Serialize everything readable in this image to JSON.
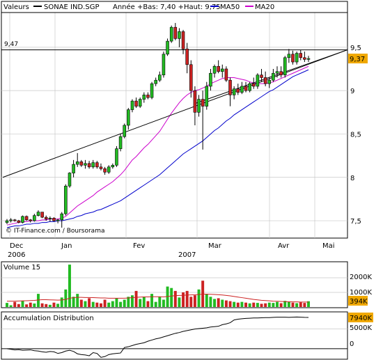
{
  "chart_data": [
    {
      "type": "candlestick",
      "legend": {
        "prefix": "Valeurs",
        "symbol": "SONAE IND.SGP",
        "range_text": "Année +Bas: 7,40 +Haut: 9,75",
        "ma50": "MA50",
        "ma20": "MA20",
        "colors": {
          "symbol": "#000000",
          "ma50": "#0000cc",
          "ma20": "#cc00cc"
        }
      },
      "y_ticks": [
        "9,5",
        "9",
        "8,5",
        "8",
        "7,5"
      ],
      "ylim": [
        7.3,
        9.9
      ],
      "reference_line": {
        "label": "9,47",
        "value": 9.47
      },
      "last_price": {
        "label": "9,37",
        "value": 9.37,
        "color": "#f0a800"
      },
      "x_ticks": [
        "Dec",
        "Jan",
        "Fev",
        "Mar",
        "Avr",
        "Mai"
      ],
      "year_labels": [
        "2006",
        "2007"
      ],
      "credit": "© IT-Finance.com / Boursorama",
      "candles": [
        [
          7.48,
          7.52,
          7.46,
          7.5
        ],
        [
          7.5,
          7.53,
          7.48,
          7.51
        ],
        [
          7.51,
          7.52,
          7.49,
          7.5
        ],
        [
          7.5,
          7.51,
          7.47,
          7.48
        ],
        [
          7.48,
          7.56,
          7.47,
          7.55
        ],
        [
          7.55,
          7.56,
          7.5,
          7.51
        ],
        [
          7.51,
          7.52,
          7.48,
          7.5
        ],
        [
          7.5,
          7.58,
          7.49,
          7.56
        ],
        [
          7.56,
          7.62,
          7.55,
          7.6
        ],
        [
          7.6,
          7.6,
          7.53,
          7.54
        ],
        [
          7.54,
          7.56,
          7.5,
          7.52
        ],
        [
          7.52,
          7.55,
          7.49,
          7.53
        ],
        [
          7.53,
          7.54,
          7.49,
          7.5
        ],
        [
          7.5,
          7.52,
          7.47,
          7.51
        ],
        [
          7.51,
          7.6,
          7.42,
          7.58
        ],
        [
          7.58,
          7.92,
          7.56,
          7.9
        ],
        [
          7.9,
          8.06,
          7.88,
          8.05
        ],
        [
          8.05,
          8.2,
          8.0,
          8.15
        ],
        [
          8.15,
          8.28,
          8.12,
          8.18
        ],
        [
          8.18,
          8.2,
          8.12,
          8.14
        ],
        [
          8.14,
          8.2,
          8.1,
          8.16
        ],
        [
          8.16,
          8.19,
          8.1,
          8.12
        ],
        [
          8.12,
          8.2,
          8.1,
          8.17
        ],
        [
          8.17,
          8.19,
          8.1,
          8.12
        ],
        [
          8.12,
          8.16,
          8.08,
          8.1
        ],
        [
          8.1,
          8.12,
          8.03,
          8.06
        ],
        [
          8.06,
          8.14,
          8.04,
          8.12
        ],
        [
          8.12,
          8.16,
          8.1,
          8.14
        ],
        [
          8.14,
          8.36,
          8.12,
          8.33
        ],
        [
          8.33,
          8.5,
          8.3,
          8.47
        ],
        [
          8.47,
          8.62,
          8.45,
          8.6
        ],
        [
          8.6,
          8.8,
          8.55,
          8.78
        ],
        [
          8.78,
          8.9,
          8.75,
          8.88
        ],
        [
          8.88,
          8.92,
          8.8,
          8.82
        ],
        [
          8.82,
          8.92,
          8.8,
          8.9
        ],
        [
          8.9,
          8.98,
          8.86,
          8.95
        ],
        [
          8.95,
          8.98,
          8.9,
          8.92
        ],
        [
          8.92,
          9.1,
          8.9,
          9.08
        ],
        [
          9.08,
          9.15,
          9.05,
          9.12
        ],
        [
          9.12,
          9.22,
          9.1,
          9.18
        ],
        [
          9.18,
          9.45,
          9.15,
          9.42
        ],
        [
          9.42,
          9.6,
          9.4,
          9.57
        ],
        [
          9.57,
          9.75,
          9.55,
          9.73
        ],
        [
          9.73,
          9.78,
          9.58,
          9.6
        ],
        [
          9.6,
          9.72,
          9.5,
          9.68
        ],
        [
          9.68,
          9.7,
          9.42,
          9.48
        ],
        [
          9.48,
          9.55,
          9.2,
          9.3
        ],
        [
          9.3,
          9.35,
          8.92,
          9.0
        ],
        [
          9.0,
          9.05,
          8.6,
          8.75
        ],
        [
          8.75,
          8.95,
          8.7,
          8.9
        ],
        [
          8.9,
          9.0,
          8.32,
          8.82
        ],
        [
          8.82,
          9.1,
          8.78,
          9.05
        ],
        [
          9.05,
          9.25,
          9.0,
          9.2
        ],
        [
          9.2,
          9.3,
          9.15,
          9.28
        ],
        [
          9.28,
          9.35,
          9.2,
          9.22
        ],
        [
          9.22,
          9.3,
          9.15,
          9.25
        ],
        [
          9.25,
          9.28,
          9.1,
          9.12
        ],
        [
          9.12,
          9.15,
          8.82,
          8.95
        ],
        [
          8.95,
          9.05,
          8.9,
          9.02
        ],
        [
          9.02,
          9.08,
          8.95,
          8.98
        ],
        [
          8.98,
          9.1,
          8.96,
          9.05
        ],
        [
          9.05,
          9.1,
          8.98,
          9.0
        ],
        [
          9.0,
          9.1,
          8.98,
          9.08
        ],
        [
          9.08,
          9.15,
          9.02,
          9.05
        ],
        [
          9.05,
          9.2,
          9.02,
          9.18
        ],
        [
          9.18,
          9.25,
          9.1,
          9.15
        ],
        [
          9.15,
          9.22,
          9.05,
          9.08
        ],
        [
          9.08,
          9.15,
          9.03,
          9.12
        ],
        [
          9.12,
          9.25,
          9.1,
          9.2
        ],
        [
          9.2,
          9.28,
          9.15,
          9.22
        ],
        [
          9.22,
          9.28,
          9.15,
          9.18
        ],
        [
          9.18,
          9.4,
          9.15,
          9.38
        ],
        [
          9.38,
          9.48,
          9.32,
          9.42
        ],
        [
          9.42,
          9.46,
          9.3,
          9.33
        ],
        [
          9.33,
          9.45,
          9.3,
          9.43
        ],
        [
          9.43,
          9.47,
          9.35,
          9.38
        ],
        [
          9.38,
          9.45,
          9.33,
          9.36
        ],
        [
          9.36,
          9.4,
          9.33,
          9.37
        ]
      ],
      "ma20": [
        7.45,
        7.46,
        7.47,
        7.48,
        7.49,
        7.49,
        7.5,
        7.5,
        7.5,
        7.51,
        7.51,
        7.52,
        7.52,
        7.52,
        7.53,
        7.55,
        7.59,
        7.63,
        7.67,
        7.7,
        7.73,
        7.76,
        7.79,
        7.83,
        7.86,
        7.89,
        7.92,
        7.95,
        7.99,
        8.03,
        8.08,
        8.14,
        8.2,
        8.24,
        8.29,
        8.34,
        8.38,
        8.43,
        8.48,
        8.53,
        8.6,
        8.67,
        8.74,
        8.8,
        8.86,
        8.91,
        8.95,
        8.98,
        9.0,
        9.01,
        9.03,
        9.05,
        9.08,
        9.1,
        9.12,
        9.14,
        9.15,
        9.15,
        9.15,
        9.14,
        9.13,
        9.12,
        9.1,
        9.09,
        9.08,
        9.08,
        9.08,
        9.09,
        9.1,
        9.12,
        9.14,
        9.16,
        9.18,
        9.2,
        9.22,
        9.24,
        9.26,
        9.28
      ],
      "ma50": [
        7.42,
        7.43,
        7.44,
        7.44,
        7.45,
        7.46,
        7.46,
        7.47,
        7.47,
        7.48,
        7.48,
        7.49,
        7.49,
        7.5,
        7.5,
        7.51,
        7.52,
        7.53,
        7.55,
        7.56,
        7.58,
        7.59,
        7.6,
        7.62,
        7.63,
        7.65,
        7.67,
        7.69,
        7.71,
        7.73,
        7.76,
        7.79,
        7.82,
        7.85,
        7.88,
        7.91,
        7.94,
        7.97,
        8.0,
        8.03,
        8.07,
        8.11,
        8.15,
        8.19,
        8.23,
        8.27,
        8.3,
        8.33,
        8.36,
        8.39,
        8.42,
        8.46,
        8.5,
        8.54,
        8.57,
        8.61,
        8.65,
        8.68,
        8.72,
        8.75,
        8.78,
        8.81,
        8.84,
        8.87,
        8.9,
        8.93,
        8.96,
        8.99,
        9.01,
        9.04,
        9.07,
        9.1,
        9.13,
        9.16,
        9.18,
        9.2,
        9.22,
        9.24
      ],
      "trendlines": [
        {
          "from": [
            0,
            8.0
          ],
          "to": [
            82,
            9.47
          ]
        },
        {
          "from": [
            49,
            8.85
          ],
          "to": [
            82,
            9.47
          ]
        }
      ],
      "grid": true
    },
    {
      "type": "bar",
      "title": "Volume 15",
      "y_ticks": [
        "2000K",
        "1000K"
      ],
      "ylim": [
        0,
        3000
      ],
      "last_value": {
        "label": "394K",
        "color": "#f0a800"
      },
      "values": [
        280,
        120,
        350,
        200,
        420,
        180,
        300,
        240,
        900,
        250,
        200,
        150,
        300,
        220,
        650,
        1200,
        2900,
        700,
        900,
        500,
        400,
        600,
        350,
        300,
        250,
        500,
        300,
        400,
        600,
        350,
        500,
        700,
        800,
        1100,
        550,
        700,
        400,
        900,
        350,
        700,
        500,
        1400,
        1300,
        1100,
        650,
        1000,
        1100,
        700,
        800,
        1200,
        1800,
        900,
        700,
        550,
        600,
        500,
        450,
        400,
        350,
        300,
        350,
        300,
        250,
        300,
        280,
        220,
        250,
        300,
        280,
        350,
        260,
        420,
        380,
        300,
        260,
        320,
        280,
        394
      ],
      "series_avg": [
        400,
        400,
        400,
        410,
        420,
        430,
        440,
        450,
        480,
        500,
        500,
        490,
        480,
        470,
        480,
        520,
        600,
        640,
        660,
        660,
        650,
        650,
        640,
        630,
        620,
        620,
        600,
        600,
        600,
        600,
        600,
        620,
        640,
        660,
        680,
        690,
        690,
        700,
        700,
        700,
        690,
        720,
        750,
        780,
        790,
        800,
        820,
        830,
        840,
        860,
        880,
        880,
        870,
        860,
        840,
        820,
        790,
        760,
        720,
        680,
        640,
        600,
        560,
        520,
        490,
        460,
        440,
        420,
        400,
        390,
        380,
        370,
        360,
        350,
        350,
        340,
        340,
        340
      ],
      "colors": {
        "up": "#22bb22",
        "down": "#cc2222",
        "avg": "#cc2222"
      }
    },
    {
      "type": "line",
      "title": "Accumulation Distribution",
      "y_ticks": [
        "5000K",
        "0"
      ],
      "ylim": [
        -2500,
        9000
      ],
      "last_value": {
        "label": "7940K",
        "color": "#f0a800"
      },
      "values": [
        0,
        -150,
        -300,
        -250,
        -400,
        -350,
        -300,
        -500,
        -600,
        -800,
        -900,
        -700,
        -800,
        -1200,
        -1000,
        -600,
        -400,
        -700,
        -1300,
        -1500,
        -1600,
        -1800,
        -1000,
        -1200,
        -2200,
        -2000,
        -1500,
        -1300,
        -1200,
        -1100,
        300,
        500,
        800,
        1100,
        1300,
        1500,
        1900,
        2200,
        2500,
        2700,
        3000,
        3300,
        3600,
        3900,
        4100,
        4400,
        4600,
        4800,
        5000,
        5100,
        5200,
        5300,
        5500,
        5600,
        5700,
        6100,
        6300,
        6600,
        7300,
        7500,
        7600,
        7700,
        7750,
        7800,
        7800,
        7850,
        7900,
        7900,
        7950,
        8000,
        8000,
        8000,
        7950,
        8000,
        8050,
        8000,
        7950,
        7940
      ],
      "color": "#000000"
    }
  ]
}
